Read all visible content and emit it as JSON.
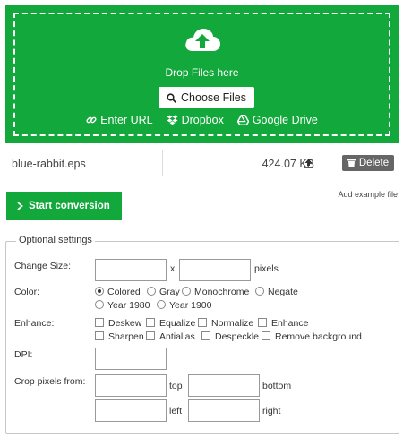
{
  "upload": {
    "drop_text": "Drop Files here",
    "choose_label": "Choose Files",
    "sources": [
      {
        "label": "Enter URL",
        "icon": "link-icon"
      },
      {
        "label": "Dropbox",
        "icon": "dropbox-icon"
      },
      {
        "label": "Google Drive",
        "icon": "google-drive-icon"
      }
    ]
  },
  "file": {
    "name": "blue-rabbit.eps",
    "size": "424.07 KB",
    "delete_label": "Delete"
  },
  "actions": {
    "start_label": "Start conversion",
    "add_example": "Add example file"
  },
  "settings": {
    "legend": "Optional settings",
    "change_size": {
      "label": "Change Size:",
      "x_label": "x",
      "unit": "pixels",
      "width": "",
      "height": ""
    },
    "color": {
      "label": "Color:",
      "options": [
        "Colored",
        "Gray",
        "Monochrome",
        "Negate",
        "Year 1980",
        "Year 1900"
      ],
      "selected": "Colored"
    },
    "enhance": {
      "label": "Enhance:",
      "options": [
        "Deskew",
        "Equalize",
        "Normalize",
        "Enhance",
        "Sharpen",
        "Antialias",
        "Despeckle",
        "Remove background"
      ]
    },
    "dpi": {
      "label": "DPI:",
      "value": ""
    },
    "crop": {
      "label": "Crop pixels from:",
      "top": "top",
      "bottom": "bottom",
      "left": "left",
      "right": "right"
    }
  },
  "colors": {
    "brand_green": "#12a83b",
    "delete_gray": "#666666"
  }
}
